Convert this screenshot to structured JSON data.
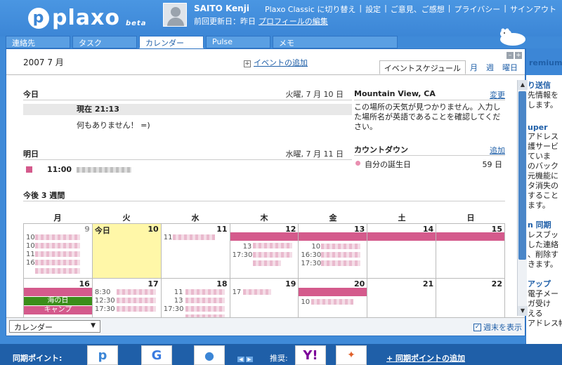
{
  "header": {
    "logo_text": "plaxo",
    "logo_beta": "beta",
    "user_name": "SAITO Kenji",
    "last_updated": "前回更新日：昨日",
    "edit_profile": "プロフィールの編集",
    "links": [
      "Plaxo Classic に切り替え",
      "設定",
      "ご意見、ご感想",
      "プライバシー",
      "サインアウト"
    ]
  },
  "tabs": [
    {
      "label": "連絡先"
    },
    {
      "label": "タスク"
    },
    {
      "label": "カレンダー"
    },
    {
      "label": "Pulse"
    },
    {
      "label": "メモ"
    }
  ],
  "calendar": {
    "month_title": "2007 7 月",
    "add_event": "イベントの追加",
    "view_tabs": [
      "イベントスケジュール",
      "月",
      "週",
      "曜日"
    ],
    "today": {
      "heading": "今日",
      "date": "火曜, 7 月 10 日",
      "now": "現在 21:13",
      "nothing": "何もありません！ =)"
    },
    "tomorrow": {
      "heading": "明日",
      "date": "水曜, 7 月 11 日",
      "event_time": "11:00"
    },
    "weather": {
      "title": "Mountain View, CA",
      "change_link": "変更",
      "message": "この場所の天気が見つかりません。入力した場所名が英語であることを確認してください。"
    },
    "countdown": {
      "title": "カウントダウン",
      "add_link": "追加",
      "item": "自分の誕生日",
      "days": "59 日"
    },
    "three_weeks": {
      "heading": "今後 3 週間",
      "weekdays": [
        "月",
        "火",
        "水",
        "木",
        "金",
        "土",
        "日"
      ],
      "week1": {
        "dates": [
          "9",
          "10",
          "11",
          "12",
          "13",
          "14",
          "15"
        ],
        "today_label": "今日",
        "mon_times": [
          "10",
          "10",
          "11",
          "16"
        ],
        "wed_times": [
          "11"
        ],
        "thu_times": [
          "13",
          "17:30"
        ],
        "fri_times": [
          "10",
          "16:30",
          "17:30"
        ]
      },
      "week2": {
        "dates": [
          "16",
          "17",
          "18",
          "19",
          "20",
          "21",
          "22"
        ],
        "holiday_green": "海の日",
        "holiday_pink": "キャンプ",
        "tue_times": [
          "8:30",
          "12:30",
          "17:30"
        ],
        "wed_times": [
          "11",
          "13",
          "17:30"
        ],
        "thu_times": [
          "17"
        ],
        "fri_times": [
          "10"
        ]
      }
    },
    "calendar_select": "カレンダー",
    "show_weekends": "週末を表示"
  },
  "sidebar": {
    "premium": "remium",
    "lines": [
      "り送信",
      "先情報を",
      "します。",
      "uper",
      "アドレス",
      "護サービ",
      "ていま",
      "のバック",
      "元機能に",
      "タ消失の",
      "すること",
      "ます。",
      "n 同期",
      "レスブッ",
      "した連絡",
      "、削除す",
      "きます。",
      "アップ",
      "電子メー",
      "ガ受け",
      "える",
      "アドレス帳"
    ]
  },
  "footer": {
    "sync_label": "同期ポイント:",
    "sync_icons": [
      "plaxo-icon",
      "google-icon",
      "apple-icon",
      "yahoo-icon",
      "windows-icon"
    ],
    "recommend": "推奨:",
    "add_sync": "+ 同期ポイントの追加"
  },
  "colors": {
    "brand_blue": "#3c86d6",
    "event_pink": "#d45a8c",
    "holiday_green": "#3b8e1a",
    "today_yellow": "#fff7a8"
  }
}
